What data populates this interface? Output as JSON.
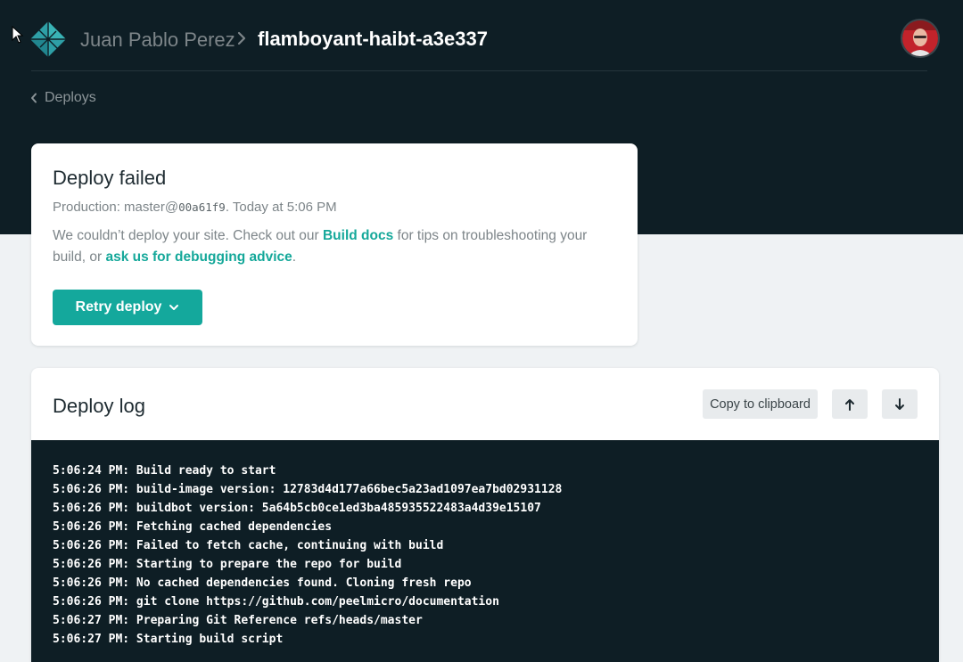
{
  "header": {
    "team_name": "Juan Pablo Perez",
    "site_name": "flamboyant-haibt-a3e337",
    "logo_icon": "netlify-logo-icon",
    "avatar_icon": "user-avatar"
  },
  "nav": {
    "back_label": "Deploys"
  },
  "deploy": {
    "title": "Deploy failed",
    "meta_prefix": "Production: master@",
    "commit": "00a61f9",
    "meta_suffix": ". Today at 5:06 PM",
    "message_part1": "We couldn’t deploy your site. Check out our ",
    "build_docs_link": "Build docs",
    "message_part2": " for tips on troubleshooting your build, or ",
    "debug_link": "ask us for debugging advice",
    "message_part3": ".",
    "retry_label": "Retry deploy"
  },
  "log": {
    "title": "Deploy log",
    "copy_label": "Copy to clipboard",
    "scroll_up_icon": "arrow-up-icon",
    "scroll_down_icon": "arrow-down-icon",
    "lines": [
      "5:06:24 PM: Build ready to start",
      "5:06:26 PM: build-image version: 12783d4d177a66bec5a23ad1097ea7bd02931128",
      "5:06:26 PM: buildbot version: 5a64b5cb0ce1ed3ba485935522483a4d39e15107",
      "5:06:26 PM: Fetching cached dependencies",
      "5:06:26 PM: Failed to fetch cache, continuing with build",
      "5:06:26 PM: Starting to prepare the repo for build",
      "5:06:26 PM: No cached dependencies found. Cloning fresh repo",
      "5:06:26 PM: git clone https://github.com/peelmicro/documentation",
      "5:06:27 PM: Preparing Git Reference refs/heads/master",
      "5:06:27 PM: Starting build script"
    ]
  },
  "colors": {
    "dark_bg": "#0e1e25",
    "accent": "#14a89c",
    "page_bg": "#eff2f4"
  }
}
